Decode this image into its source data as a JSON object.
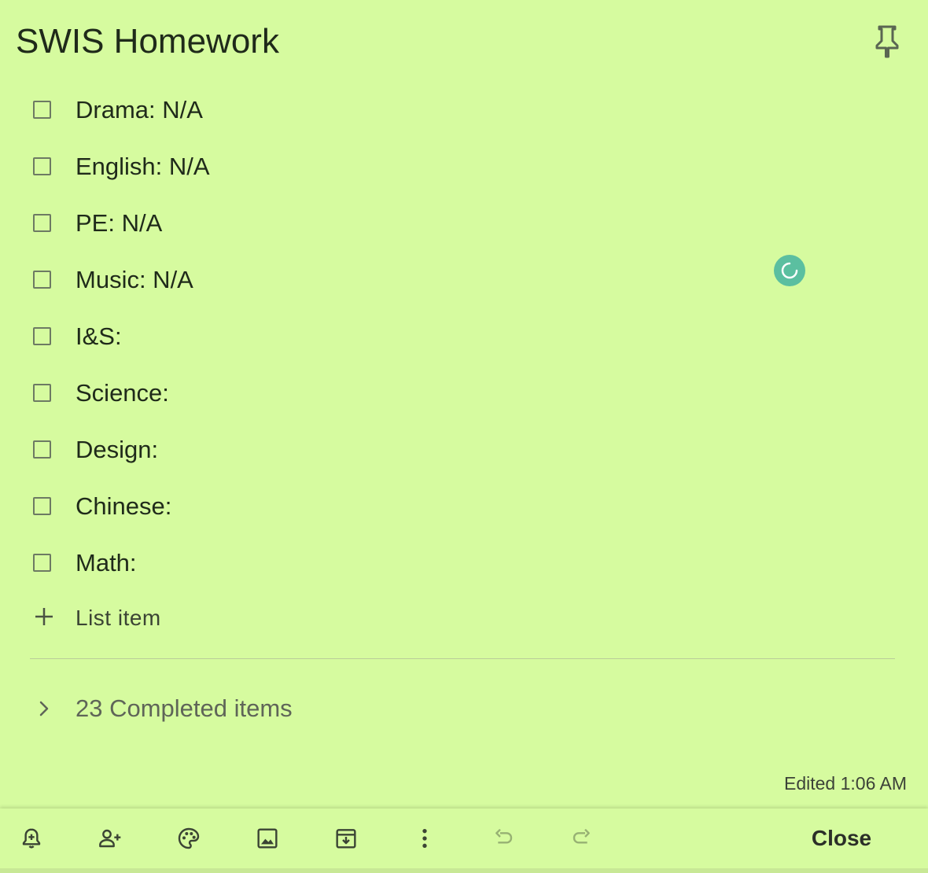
{
  "note": {
    "title": "SWIS Homework",
    "items": [
      {
        "text": "Drama: N/A",
        "checked": false
      },
      {
        "text": "English: N/A",
        "checked": false
      },
      {
        "text": "PE: N/A",
        "checked": false
      },
      {
        "text": "Music: N/A",
        "checked": false
      },
      {
        "text": "I&S:",
        "checked": false
      },
      {
        "text": "Science:",
        "checked": false
      },
      {
        "text": "Design:",
        "checked": false
      },
      {
        "text": "Chinese:",
        "checked": false
      },
      {
        "text": "Math:",
        "checked": false
      }
    ],
    "add_item_label": "List item",
    "completed_label": "23 Completed items",
    "edited_label": "Edited 1:06 AM"
  },
  "toolbar": {
    "icons": [
      "remind-me-icon",
      "collaborator-icon",
      "palette-icon",
      "add-image-icon",
      "archive-icon",
      "more-icon",
      "undo-icon",
      "redo-icon"
    ],
    "close_label": "Close"
  },
  "colors": {
    "note_background": "#d6fb9f",
    "spinner": "#5bbfa0"
  }
}
